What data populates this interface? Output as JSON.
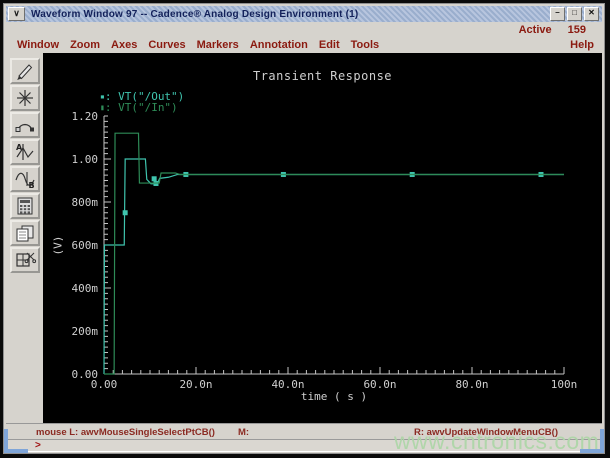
{
  "window": {
    "title": "Waveform Window 97 -- Cadence® Analog Design Environment (1)",
    "menu_icon_glyph": "∨",
    "minimize_glyph": "–",
    "maximize_glyph": "□",
    "close_glyph": "✕"
  },
  "status_row": {
    "active_label": "Active",
    "active_value": "159"
  },
  "menubar": {
    "items": [
      "Window",
      "Zoom",
      "Axes",
      "Curves",
      "Markers",
      "Annotation",
      "Edit",
      "Tools"
    ],
    "help_label": "Help"
  },
  "toolbar": {
    "icons": [
      "pen-icon",
      "starburst-icon",
      "arc-probe-icon",
      "waveform-marker-a-icon",
      "waveform-marker-b-icon",
      "calculator-icon",
      "copy-pages-icon",
      "window-cut-icon"
    ]
  },
  "statusbar": {
    "mouse_left": "mouse L: awvMouseSingleSelectPtCB()",
    "mouse_middle": "M:",
    "mouse_right": "R: awvUpdateWindowMenuCB()",
    "prompt": ">"
  },
  "watermark": "www.cntronics.com",
  "chart_data": {
    "type": "line",
    "title": "Transient Response",
    "xlabel": "time ( s )",
    "ylabel": "(V)",
    "x_unit": "ns",
    "xlim": [
      0,
      100
    ],
    "ylim": [
      0,
      1.2
    ],
    "grid": false,
    "legend_position": "top-left",
    "legend_separator": ":",
    "x_ticks": [
      {
        "v": 0,
        "label": "0.00"
      },
      {
        "v": 20,
        "label": "20.0n"
      },
      {
        "v": 40,
        "label": "40.0n"
      },
      {
        "v": 60,
        "label": "60.0n"
      },
      {
        "v": 80,
        "label": "80.0n"
      },
      {
        "v": 100,
        "label": "100n"
      }
    ],
    "y_ticks": [
      {
        "v": 0,
        "label": "0.00"
      },
      {
        "v": 0.2,
        "label": "200m"
      },
      {
        "v": 0.4,
        "label": "400m"
      },
      {
        "v": 0.6,
        "label": "600m"
      },
      {
        "v": 0.8,
        "label": "800m"
      },
      {
        "v": 1.0,
        "label": "1.00"
      },
      {
        "v": 1.2,
        "label": "1.20"
      }
    ],
    "x_minor_step": 2,
    "y_minor_step": 0.025,
    "series": [
      {
        "name": "VT(\"/Out\")",
        "color": "#3fc4ae",
        "legend_marker": "▪",
        "points": [
          [
            0,
            0
          ],
          [
            0.1,
            0.6
          ],
          [
            4.4,
            0.6
          ],
          [
            4.6,
            1.0
          ],
          [
            9.0,
            1.0
          ],
          [
            9.3,
            0.905
          ],
          [
            10.2,
            0.885
          ],
          [
            11.6,
            0.885
          ],
          [
            12.1,
            0.91
          ],
          [
            14.0,
            0.915
          ],
          [
            16.0,
            0.928
          ],
          [
            100,
            0.928
          ]
        ],
        "markers": [
          [
            4.6,
            0.75
          ],
          [
            10.9,
            0.908
          ],
          [
            11.3,
            0.886
          ],
          [
            17.8,
            0.928
          ],
          [
            39,
            0.928
          ],
          [
            67,
            0.928
          ],
          [
            95,
            0.928
          ]
        ]
      },
      {
        "name": "VT(\"/In\")",
        "color": "#2e8b57",
        "legend_marker": "▮",
        "points": [
          [
            0,
            0
          ],
          [
            2.2,
            0
          ],
          [
            2.4,
            1.12
          ],
          [
            7.5,
            1.12
          ],
          [
            7.7,
            0.888
          ],
          [
            12.0,
            0.888
          ],
          [
            12.4,
            0.935
          ],
          [
            15.5,
            0.935
          ],
          [
            16.5,
            0.928
          ],
          [
            100,
            0.928
          ]
        ],
        "markers": []
      }
    ]
  }
}
